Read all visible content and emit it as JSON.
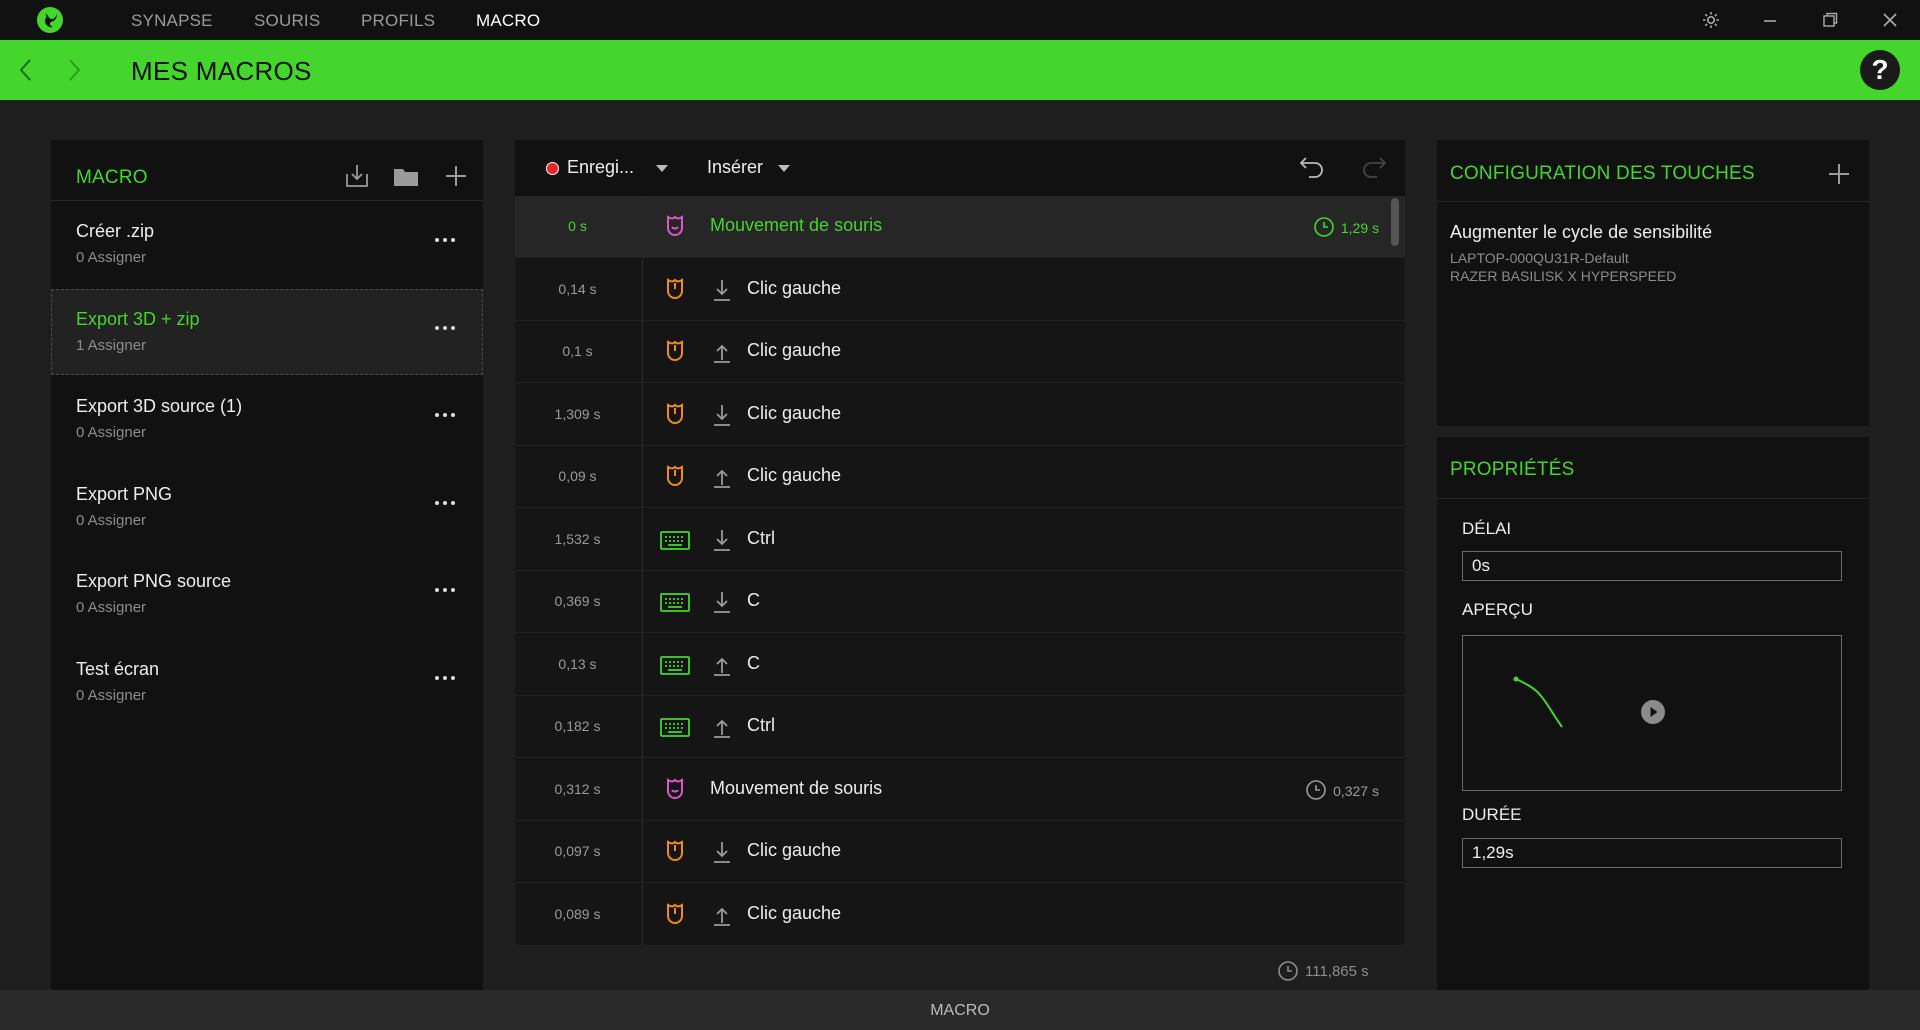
{
  "topnav": [
    "SYNAPSE",
    "SOURIS",
    "PROFILS",
    "MACRO"
  ],
  "header": {
    "title": "MES MACROS",
    "help": "?"
  },
  "macro_panel": {
    "title": "MACRO",
    "items": [
      {
        "name": "Créer .zip",
        "assign": "0 Assigner"
      },
      {
        "name": "Export 3D + zip",
        "assign": "1 Assigner"
      },
      {
        "name": "Export 3D source (1)",
        "assign": "0 Assigner"
      },
      {
        "name": "Export PNG",
        "assign": "0 Assigner"
      },
      {
        "name": "Export PNG source",
        "assign": "0 Assigner"
      },
      {
        "name": "Test écran",
        "assign": "0 Assigner"
      }
    ],
    "selected_index": 1
  },
  "editor": {
    "record_label": "Enregi...",
    "insert_label": "Insérer",
    "events": [
      {
        "time": "0 s",
        "device": "mouse-move",
        "action": "none",
        "label": "Mouvement de souris",
        "duration": "1,29 s"
      },
      {
        "time": "0,14 s",
        "device": "mouse-click",
        "action": "down",
        "label": "Clic gauche"
      },
      {
        "time": "0,1 s",
        "device": "mouse-click",
        "action": "up",
        "label": "Clic gauche"
      },
      {
        "time": "1,309 s",
        "device": "mouse-click",
        "action": "down",
        "label": "Clic gauche"
      },
      {
        "time": "0,09 s",
        "device": "mouse-click",
        "action": "up",
        "label": "Clic gauche"
      },
      {
        "time": "1,532 s",
        "device": "keyboard",
        "action": "down",
        "label": "Ctrl"
      },
      {
        "time": "0,369 s",
        "device": "keyboard",
        "action": "down",
        "label": "C"
      },
      {
        "time": "0,13 s",
        "device": "keyboard",
        "action": "up",
        "label": "C"
      },
      {
        "time": "0,182 s",
        "device": "keyboard",
        "action": "up",
        "label": "Ctrl"
      },
      {
        "time": "0,312 s",
        "device": "mouse-move",
        "action": "none",
        "label": "Mouvement de souris",
        "duration": "0,327 s"
      },
      {
        "time": "0,097 s",
        "device": "mouse-click",
        "action": "down",
        "label": "Clic gauche"
      },
      {
        "time": "0,089 s",
        "device": "mouse-click",
        "action": "up",
        "label": "Clic gauche"
      }
    ],
    "total_duration": "111,865 s"
  },
  "keybind_panel": {
    "title": "CONFIGURATION DES TOUCHES",
    "binding": "Augmenter le cycle de sensibilité",
    "profile": "LAPTOP-000QU31R-Default",
    "device": "RAZER BASILISK X HYPERSPEED"
  },
  "properties_panel": {
    "title": "PROPRIÉTÉS",
    "delay_label": "DÉLAI",
    "delay_value": "0s",
    "preview_label": "APERÇU",
    "duration_label": "DURÉE",
    "duration_value": "1,29s"
  },
  "bottom_bar": {
    "label": "MACRO"
  },
  "colors": {
    "accent": "#44d62c",
    "mouse_move": "#d957c9",
    "mouse_click": "#f28a1a",
    "keyboard": "#44d62c",
    "record": "#e4262a"
  }
}
